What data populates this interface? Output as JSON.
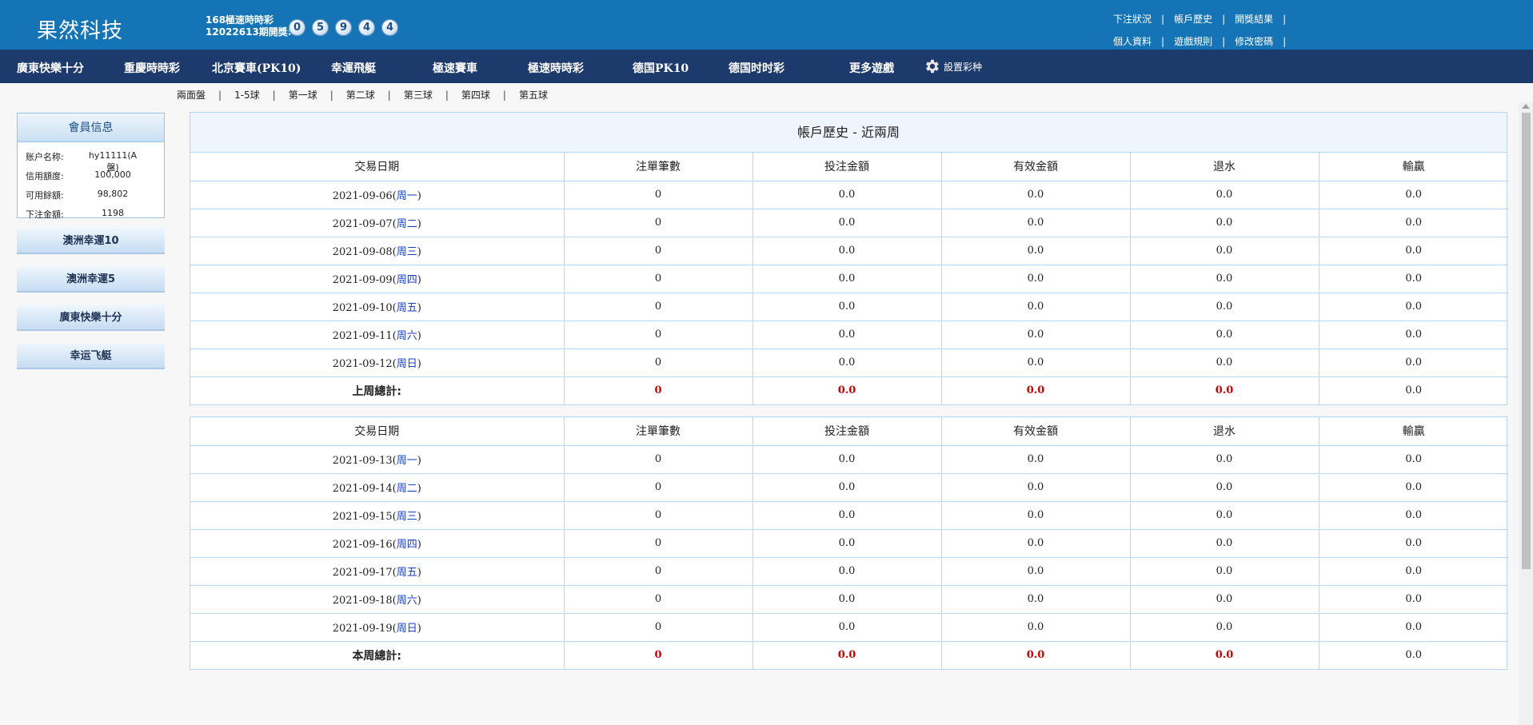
{
  "header": {
    "brand": "果然科技",
    "lottery_name": "168極速時時彩",
    "draw_label": "12022613期開獎:",
    "balls": [
      "0",
      "5",
      "9",
      "4",
      "4"
    ],
    "links_row1": [
      "下注狀況",
      "帳戶歷史",
      "開獎結果"
    ],
    "links_row2": [
      "個人資料",
      "遊戲規則",
      "修改密碼"
    ]
  },
  "nav": {
    "items": [
      "廣東快樂十分",
      "重慶時時彩",
      "北京賽車(PK10)",
      "幸運飛艇",
      "極速賽車",
      "極速時時彩",
      "德国PK10",
      "德国时时彩",
      "更多遊戲"
    ],
    "settings_label": "設置彩种"
  },
  "subnav": [
    "兩面盤",
    "1-5球",
    "第一球",
    "第二球",
    "第三球",
    "第四球",
    "第五球"
  ],
  "sidebar": {
    "member_title": "會員信息",
    "rows": [
      {
        "key": "账户名称:",
        "value": "hy11111(A盤)"
      },
      {
        "key": "信用額度:",
        "value": "100,000"
      },
      {
        "key": "可用餘額:",
        "value": "98,802"
      },
      {
        "key": "下注金額:",
        "value": "1198"
      }
    ],
    "buttons": [
      "澳洲幸運10",
      "澳洲幸運5",
      "廣東快樂十分",
      "幸运飞艇"
    ]
  },
  "history": {
    "title": "帳戶歷史 - 近兩周",
    "columns": [
      "交易日期",
      "注單筆數",
      "投注金額",
      "有效金額",
      "退水",
      "輸贏"
    ],
    "last_week": {
      "rows": [
        {
          "date": "2021-09-06(",
          "day": "周一",
          "close": ")",
          "count": "0",
          "bet": "0.0",
          "valid": "0.0",
          "rebate": "0.0",
          "win": "0.0"
        },
        {
          "date": "2021-09-07(",
          "day": "周二",
          "close": ")",
          "count": "0",
          "bet": "0.0",
          "valid": "0.0",
          "rebate": "0.0",
          "win": "0.0"
        },
        {
          "date": "2021-09-08(",
          "day": "周三",
          "close": ")",
          "count": "0",
          "bet": "0.0",
          "valid": "0.0",
          "rebate": "0.0",
          "win": "0.0"
        },
        {
          "date": "2021-09-09(",
          "day": "周四",
          "close": ")",
          "count": "0",
          "bet": "0.0",
          "valid": "0.0",
          "rebate": "0.0",
          "win": "0.0"
        },
        {
          "date": "2021-09-10(",
          "day": "周五",
          "close": ")",
          "count": "0",
          "bet": "0.0",
          "valid": "0.0",
          "rebate": "0.0",
          "win": "0.0"
        },
        {
          "date": "2021-09-11(",
          "day": "周六",
          "close": ")",
          "count": "0",
          "bet": "0.0",
          "valid": "0.0",
          "rebate": "0.0",
          "win": "0.0"
        },
        {
          "date": "2021-09-12(",
          "day": "周日",
          "close": ")",
          "count": "0",
          "bet": "0.0",
          "valid": "0.0",
          "rebate": "0.0",
          "win": "0.0"
        }
      ],
      "total": {
        "label": "上周總計:",
        "count": "0",
        "bet": "0.0",
        "valid": "0.0",
        "rebate": "0.0",
        "win": "0.0"
      }
    },
    "this_week": {
      "rows": [
        {
          "date": "2021-09-13(",
          "day": "周一",
          "close": ")",
          "count": "0",
          "bet": "0.0",
          "valid": "0.0",
          "rebate": "0.0",
          "win": "0.0"
        },
        {
          "date": "2021-09-14(",
          "day": "周二",
          "close": ")",
          "count": "0",
          "bet": "0.0",
          "valid": "0.0",
          "rebate": "0.0",
          "win": "0.0"
        },
        {
          "date": "2021-09-15(",
          "day": "周三",
          "close": ")",
          "count": "0",
          "bet": "0.0",
          "valid": "0.0",
          "rebate": "0.0",
          "win": "0.0"
        },
        {
          "date": "2021-09-16(",
          "day": "周四",
          "close": ")",
          "count": "0",
          "bet": "0.0",
          "valid": "0.0",
          "rebate": "0.0",
          "win": "0.0"
        },
        {
          "date": "2021-09-17(",
          "day": "周五",
          "close": ")",
          "count": "0",
          "bet": "0.0",
          "valid": "0.0",
          "rebate": "0.0",
          "win": "0.0"
        },
        {
          "date": "2021-09-18(",
          "day": "周六",
          "close": ")",
          "count": "0",
          "bet": "0.0",
          "valid": "0.0",
          "rebate": "0.0",
          "win": "0.0"
        },
        {
          "date": "2021-09-19(",
          "day": "周日",
          "close": ")",
          "count": "0",
          "bet": "0.0",
          "valid": "0.0",
          "rebate": "0.0",
          "win": "0.0"
        }
      ],
      "total": {
        "label": "本周總計:",
        "count": "0",
        "bet": "0.0",
        "valid": "0.0",
        "rebate": "0.0",
        "win": "0.0"
      }
    }
  },
  "colors": {
    "header": "#1474b5",
    "nav": "#1c3a6b",
    "accent_red": "#d00000",
    "weekday_link": "#1a3ec9"
  }
}
